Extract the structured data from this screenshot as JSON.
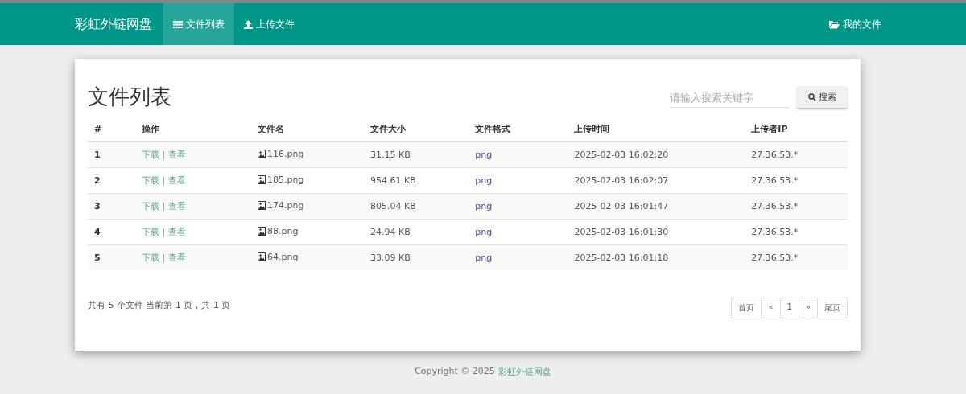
{
  "navbar": {
    "brand": "彩虹外链网盘",
    "tabs": [
      {
        "label": "文件列表",
        "selected": true
      },
      {
        "label": "上传文件",
        "selected": false
      }
    ],
    "right_link": {
      "label": "我的文件"
    }
  },
  "panel": {
    "title": "文件列表",
    "search": {
      "placeholder": "请输入搜索关键字",
      "button": "搜索"
    },
    "table": {
      "columns": [
        "#",
        "操作",
        "文件名",
        "文件大小",
        "文件格式",
        "上传时间",
        "上传者IP"
      ],
      "rows": [
        {
          "index": "1",
          "actions": [
            "下载",
            "查看"
          ],
          "name": "116.png",
          "size": "31.15 KB",
          "format": "png",
          "time": "2025-02-03 16:02:20",
          "ip": "27.36.53.*"
        },
        {
          "index": "2",
          "actions": [
            "下载",
            "查看"
          ],
          "name": "185.png",
          "size": "954.61 KB",
          "format": "png",
          "time": "2025-02-03 16:02:07",
          "ip": "27.36.53.*"
        },
        {
          "index": "3",
          "actions": [
            "下载",
            "查看"
          ],
          "name": "174.png",
          "size": "805.04 KB",
          "format": "png",
          "time": "2025-02-03 16:01:47",
          "ip": "27.36.53.*"
        },
        {
          "index": "4",
          "actions": [
            "下载",
            "查看"
          ],
          "name": "88.png",
          "size": "24.94 KB",
          "format": "png",
          "time": "2025-02-03 16:01:30",
          "ip": "27.36.53.*"
        },
        {
          "index": "5",
          "actions": [
            "下载",
            "查看"
          ],
          "name": "64.png",
          "size": "33.09 KB",
          "format": "png",
          "time": "2025-02-03 16:01:18",
          "ip": "27.36.53.*"
        }
      ],
      "action_separator": "|"
    },
    "summary": "共有 5 个文件  当前第 1 页，共 1 页",
    "pagination": [
      "首页",
      "«",
      "1",
      "»",
      "尾页"
    ]
  },
  "footer": {
    "text": "Copyright © 2025",
    "link": "彩虹外链网盘"
  }
}
